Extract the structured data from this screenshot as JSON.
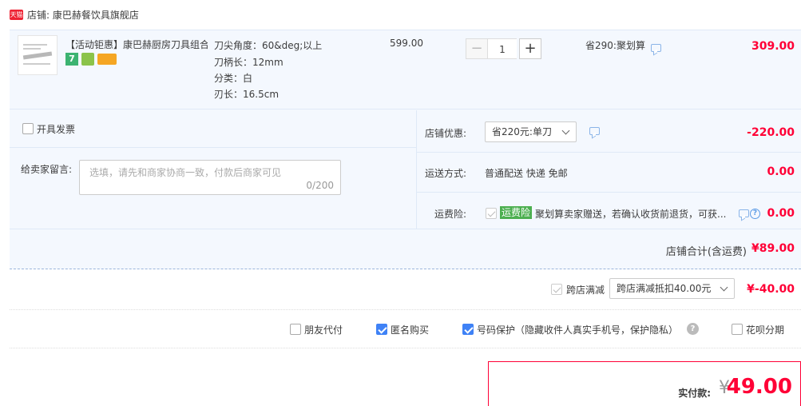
{
  "shop": {
    "badge": "天猫",
    "label": "店铺: 康巴赫餐饮具旗舰店"
  },
  "item": {
    "title": "【活动钜惠】康巴赫厨房刀具组合",
    "specs": [
      "刀尖角度：60&deg;以上",
      "刀柄长：12mm",
      "分类：白",
      "刃长：16.5cm"
    ],
    "unit_price": "599.00",
    "quantity": "1",
    "minus": "−",
    "plus": "+",
    "save": "省290:聚划算",
    "subtotal": "309.00",
    "icon_seven": "7"
  },
  "invoice": {
    "label": "开具发票",
    "checked": false
  },
  "message": {
    "label": "给卖家留言:",
    "placeholder": "选填，请先和商家协商一致，付款后商家可见",
    "count": "0/200"
  },
  "shop_discount": {
    "label": "店铺优惠:",
    "selected": "省220元:单刀",
    "amount": "-220.00"
  },
  "delivery": {
    "label": "运送方式:",
    "value": "普通配送 快递 免邮",
    "amount": "0.00"
  },
  "shipping_insurance": {
    "label": "运费险:",
    "tag": "运费险",
    "text": "聚划算卖家赠送，若确认收货前退货，可获...",
    "help": "?",
    "amount": "0.00"
  },
  "shop_total": {
    "label": "店铺合计(含运费)",
    "amount": "¥89.00"
  },
  "cross_store": {
    "label": "跨店满减",
    "selected": "跨店满减抵扣40.00元",
    "amount": "¥-40.00"
  },
  "options": {
    "friend_pay": "朋友代付",
    "anonymous": "匿名购买",
    "number_protect": "号码保护（隐藏收件人真实手机号，保护隐私）",
    "help": "?",
    "huabei": "花呗分期"
  },
  "payment": {
    "label": "实付款:",
    "currency": "¥",
    "amount": "49.00"
  },
  "colors": {
    "accent_red": "#ff0036",
    "panel_bg": "#f4f8fe",
    "check_blue": "#3f82f6",
    "insurance_green": "#4caf50"
  }
}
